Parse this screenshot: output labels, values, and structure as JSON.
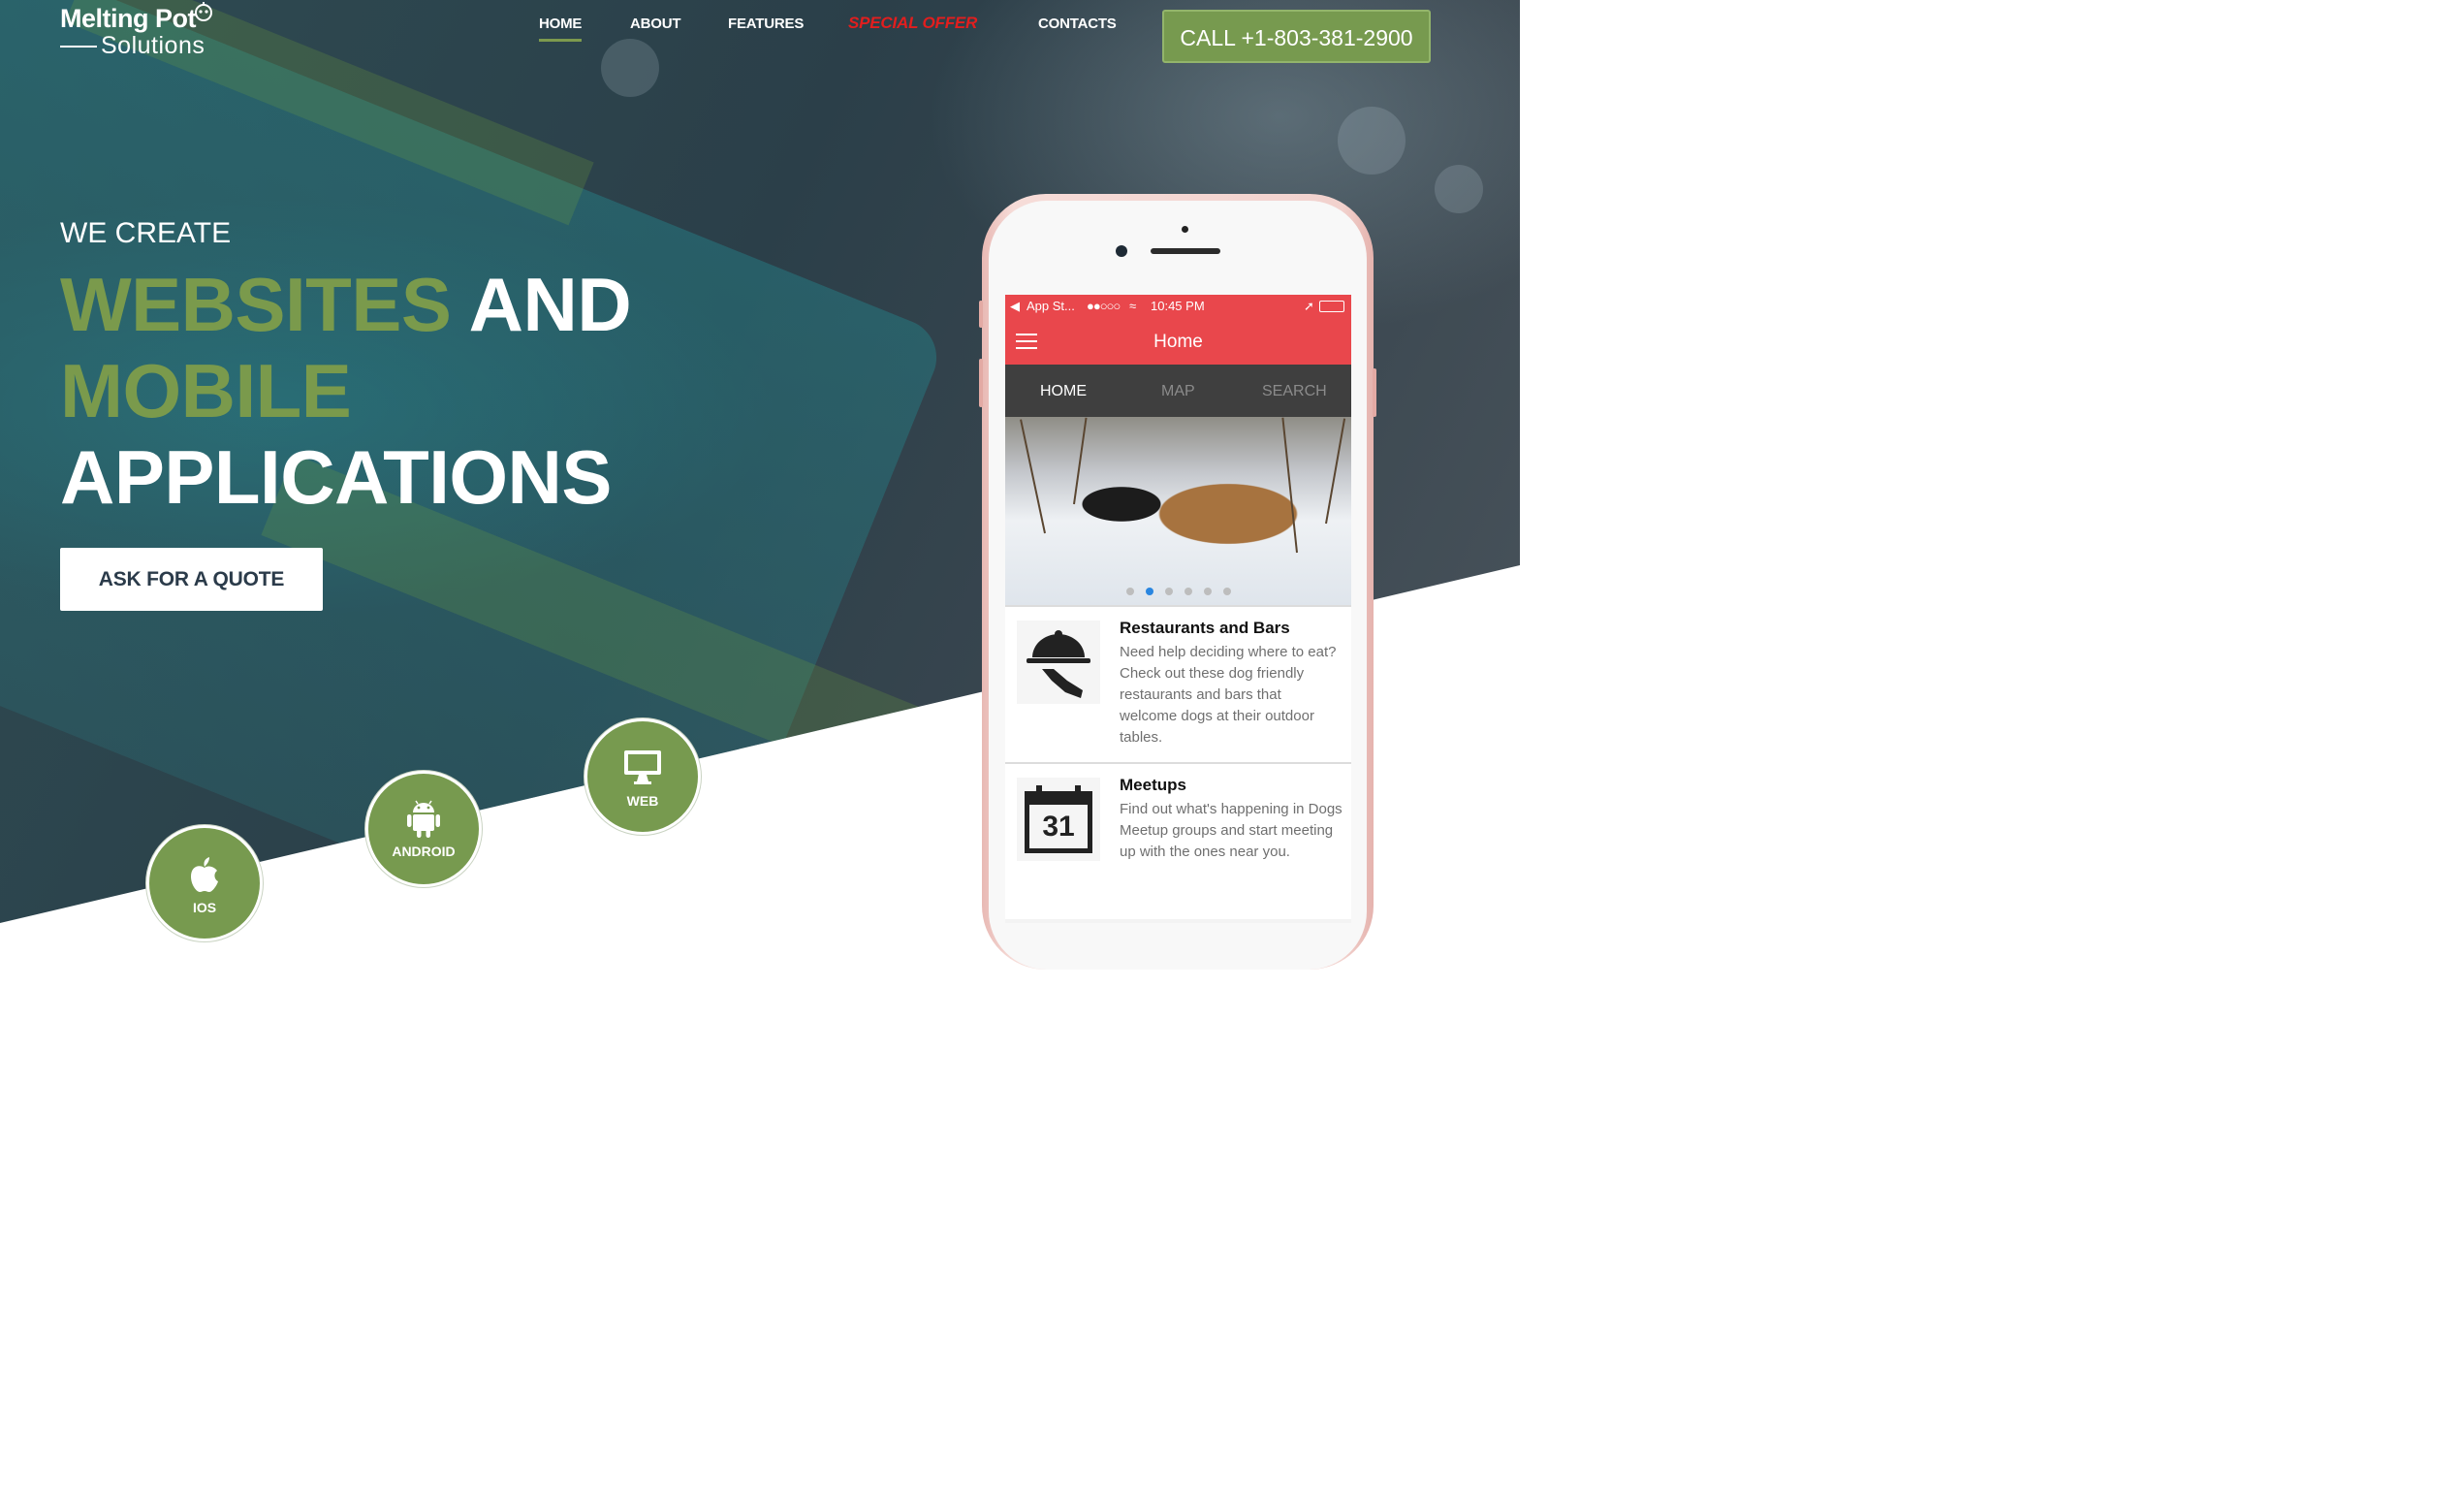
{
  "logo": {
    "line1": "Melting Pot",
    "line2": "Solutions"
  },
  "nav": {
    "items": [
      {
        "label": "HOME",
        "active": true
      },
      {
        "label": "ABOUT"
      },
      {
        "label": "FEATURES"
      },
      {
        "label": "SPECIAL OFFER"
      },
      {
        "label": "CONTACTS"
      }
    ],
    "call_label": "CALL +1-803-381-2900"
  },
  "hero": {
    "subhead": "WE CREATE",
    "line1_green": "WEBSITES",
    "line1_white": "AND",
    "line2_green": "MOBILE",
    "line3_white": "APPLICATIONS",
    "cta_label": "ASK FOR A QUOTE"
  },
  "platforms": [
    {
      "label": "IOS",
      "icon": "apple-icon"
    },
    {
      "label": "ANDROID",
      "icon": "android-icon"
    },
    {
      "label": "WEB",
      "icon": "monitor-icon"
    }
  ],
  "colors": {
    "accent_green": "#779a4f",
    "offer_red": "#e21e1e",
    "app_red": "#e9474c"
  },
  "phone": {
    "status": {
      "back": "App St...",
      "signal": "●●○○○",
      "time": "10:45 PM"
    },
    "app_title": "Home",
    "tabs": [
      "HOME",
      "MAP",
      "SEARCH"
    ],
    "slide_dots": {
      "active_index": 1
    },
    "list": [
      {
        "title": "Restaurants and Bars",
        "desc": "Need help deciding where to eat? Check out these dog friendly restaurants and bars that welcome dogs at their outdoor tables.",
        "icon": "cloche-icon"
      },
      {
        "title": "Meetups",
        "desc": "Find out what's happening in Dogs Meetup groups and start meeting up with the ones near you.",
        "icon": "calendar-icon",
        "icon_text": "31"
      }
    ]
  }
}
